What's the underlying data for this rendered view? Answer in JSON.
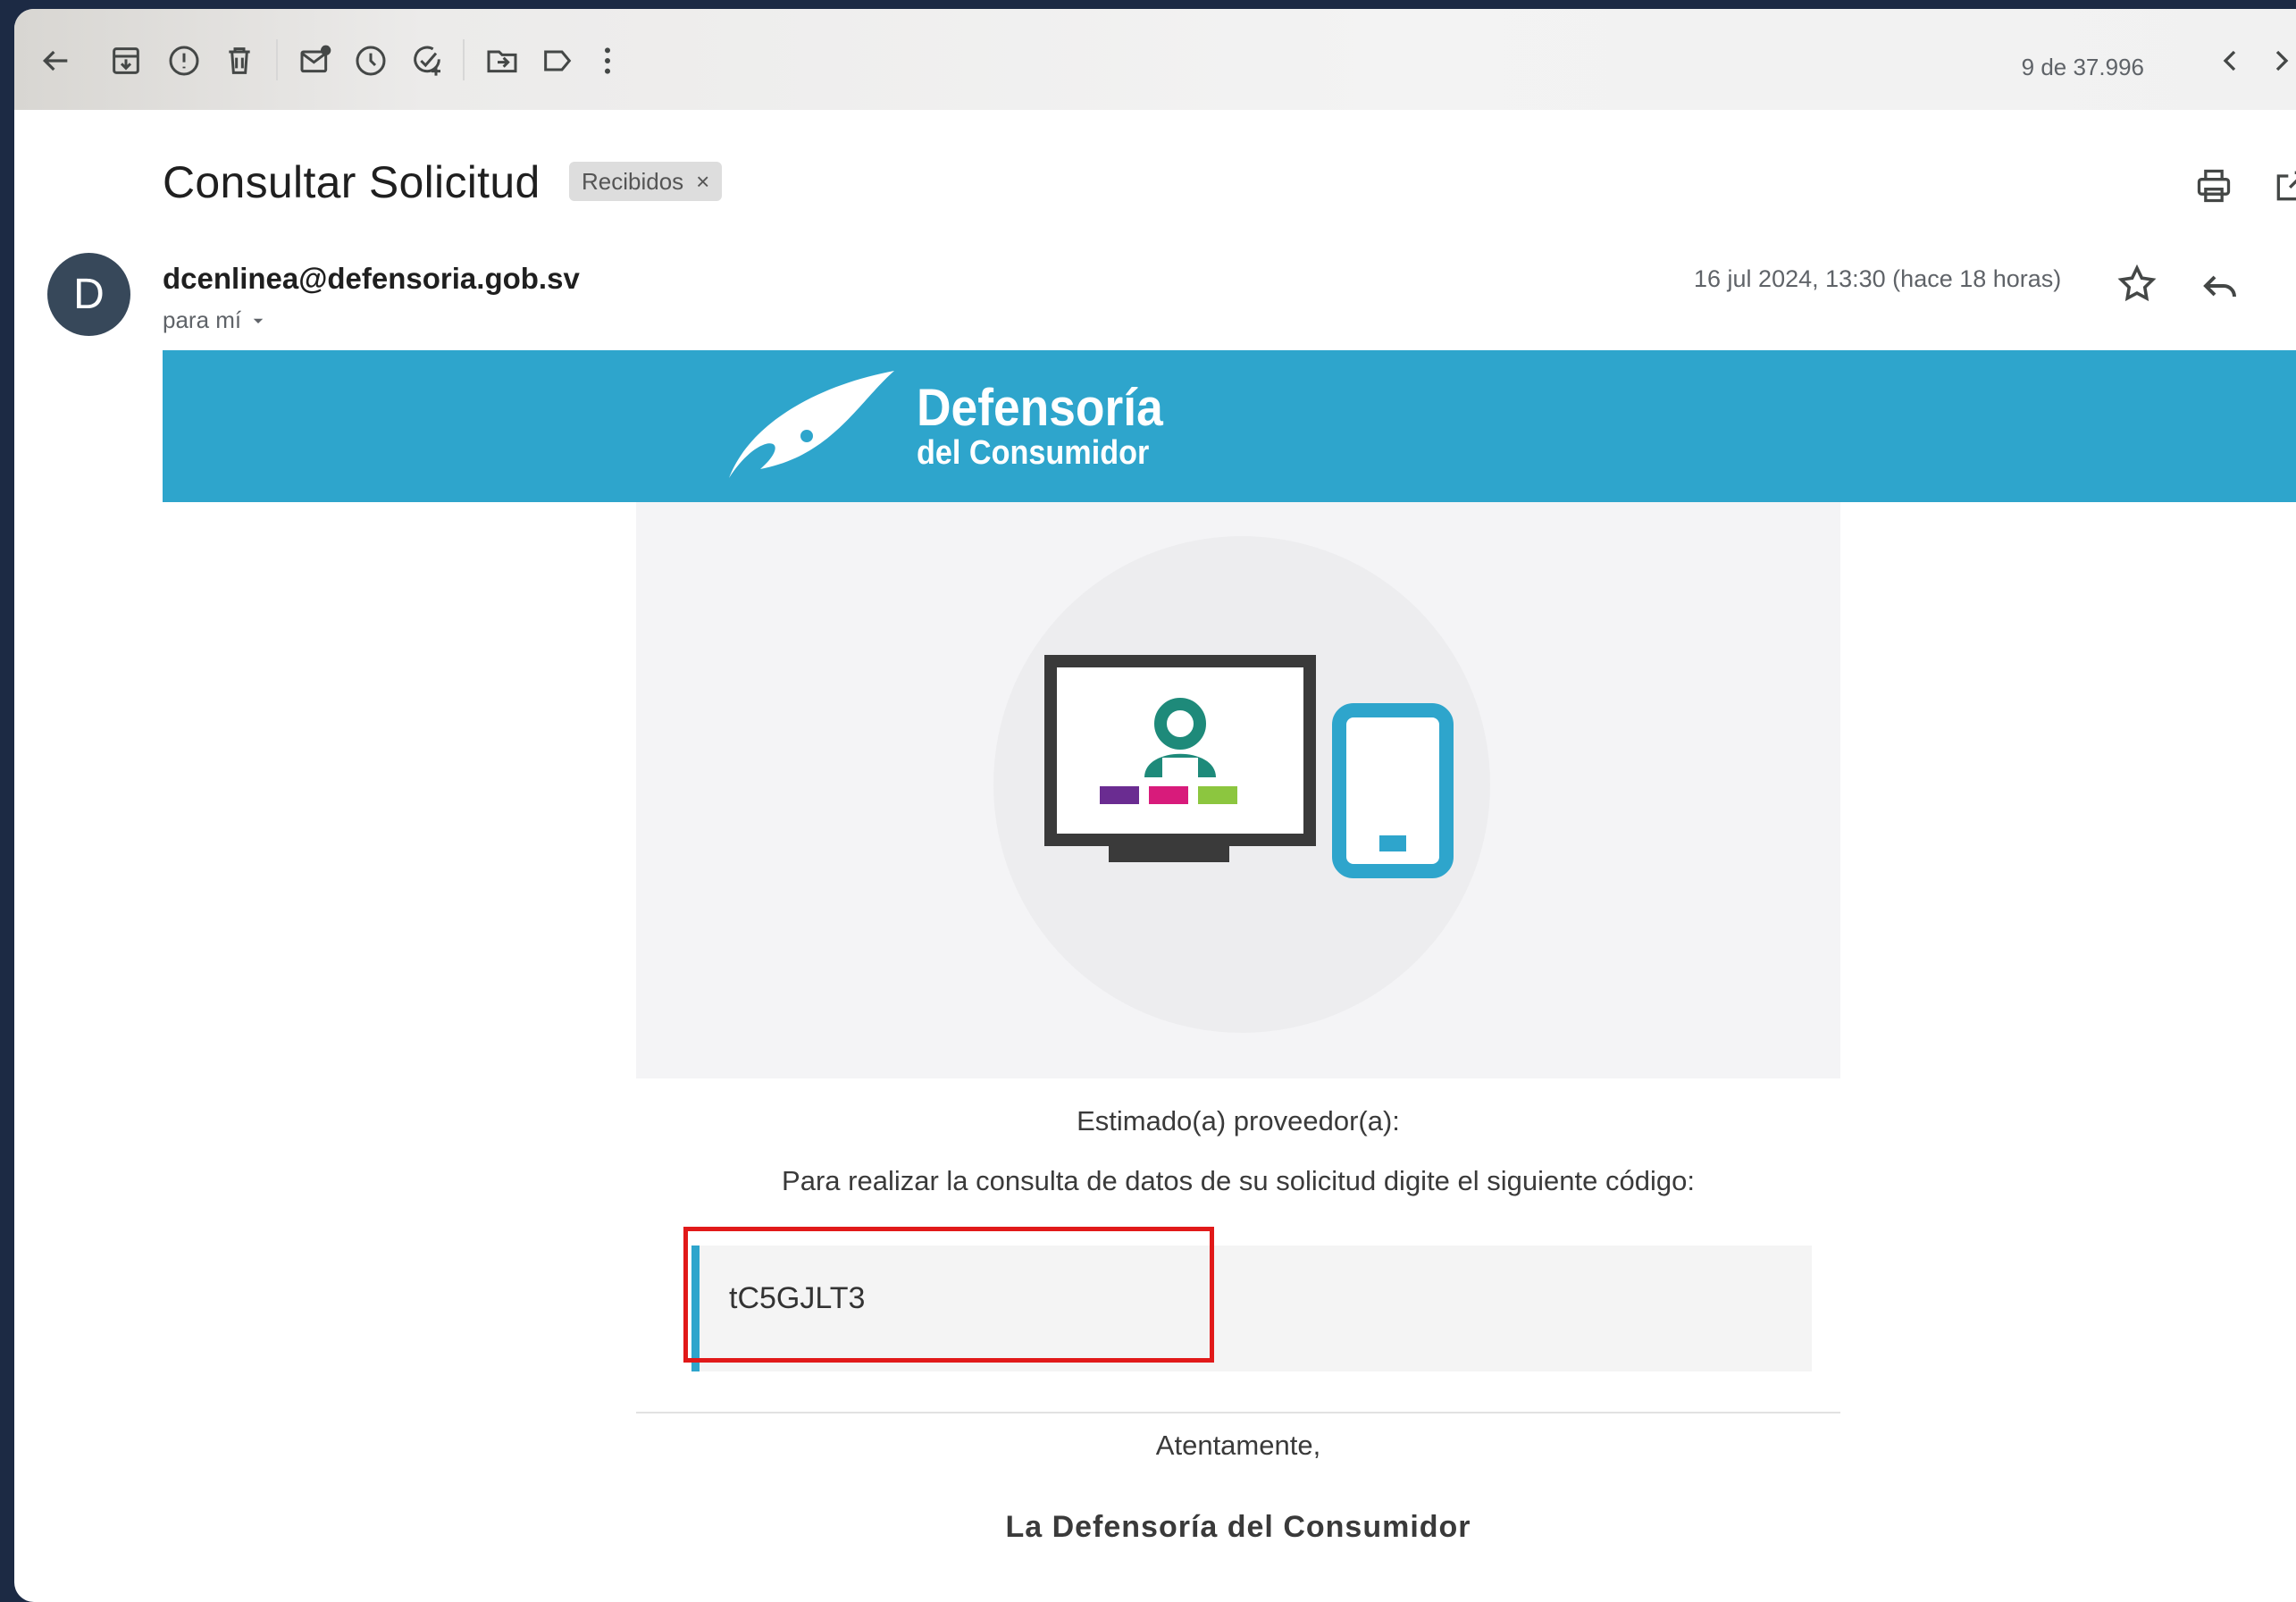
{
  "toolbar": {
    "counter": "9 de 37.996",
    "icons": [
      "back-arrow-icon",
      "archive-icon",
      "report-spam-icon",
      "delete-icon",
      "mark-unread-icon",
      "snooze-icon",
      "add-task-icon",
      "move-to-icon",
      "label-icon",
      "more-vert-icon",
      "prev-icon",
      "next-icon"
    ]
  },
  "email": {
    "subject": "Consultar Solicitud",
    "label": "Recibidos",
    "label_remove": "×",
    "avatar_letter": "D",
    "sender": "dcenlinea@defensoria.gob.sv",
    "to": "para mí",
    "date": "16 jul 2024, 13:30 (hace 18 horas)"
  },
  "body": {
    "logo_line1": "Defensoría",
    "logo_line2": "del Consumidor",
    "greeting": "Estimado(a) proveedor(a):",
    "instruction": "Para realizar la consulta de datos de su solicitud digite el siguiente código:",
    "code": "tC5GJLT3",
    "closing": "Atentamente,",
    "signature": "La Defensoría del Consumidor"
  },
  "colors": {
    "brand_blue": "#2ea5cc",
    "avatar_bg": "#37485a",
    "highlight_red": "#e11919",
    "teal": "#1e8a7a",
    "purple": "#6a2c91",
    "magenta": "#d81b7b",
    "green": "#8cc63f"
  }
}
